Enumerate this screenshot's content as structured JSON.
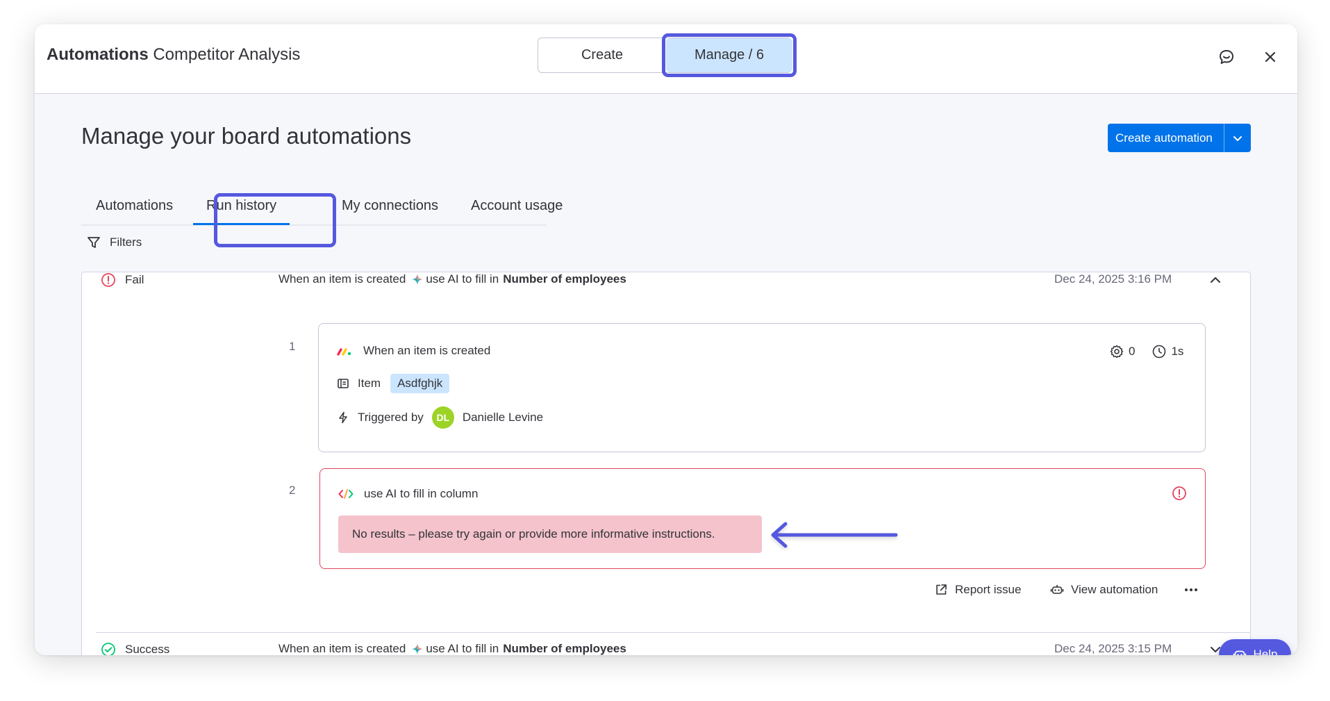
{
  "window": {
    "title_bold": "Automations",
    "board_name": "Competitor Analysis",
    "segments": {
      "create": "Create",
      "manage": "Manage / 6"
    }
  },
  "page": {
    "heading": "Manage your board automations",
    "create_button": "Create automation",
    "tabs": [
      "Automations",
      "Run history",
      "My connections",
      "Account usage"
    ],
    "active_tab": "Run history",
    "filters_label": "Filters"
  },
  "runs": [
    {
      "status": "Fail",
      "trigger_text": "When an item is created",
      "action_text": "use AI to fill in",
      "column_name": "Number of employees",
      "date": "Dec 24, 2025 3:16 PM",
      "expanded": true,
      "steps": [
        {
          "number": "1",
          "title": "When an item is created",
          "retries": "0",
          "duration": "1s",
          "item_label": "Item",
          "item_value": "Asdfghjk",
          "triggered_by_label": "Triggered by",
          "user_initials": "DL",
          "user_name": "Danielle Levine"
        },
        {
          "number": "2",
          "title": "use AI to fill in column",
          "error_message": "No results – please try again or provide more informative instructions."
        }
      ],
      "actions": {
        "report": "Report issue",
        "view": "View automation"
      }
    },
    {
      "status": "Success",
      "trigger_text": "When an item is created",
      "action_text": "use AI to fill in",
      "column_name": "Number of employees",
      "date": "Dec 24, 2025 3:15 PM",
      "expanded": false
    }
  ],
  "help_label": "Help",
  "colors": {
    "primary": "#0073ea",
    "highlight": "#5559df",
    "fail": "#e2445c",
    "success": "#00c875",
    "chip": "#cce5ff",
    "error_bg": "#f4c3cb"
  }
}
